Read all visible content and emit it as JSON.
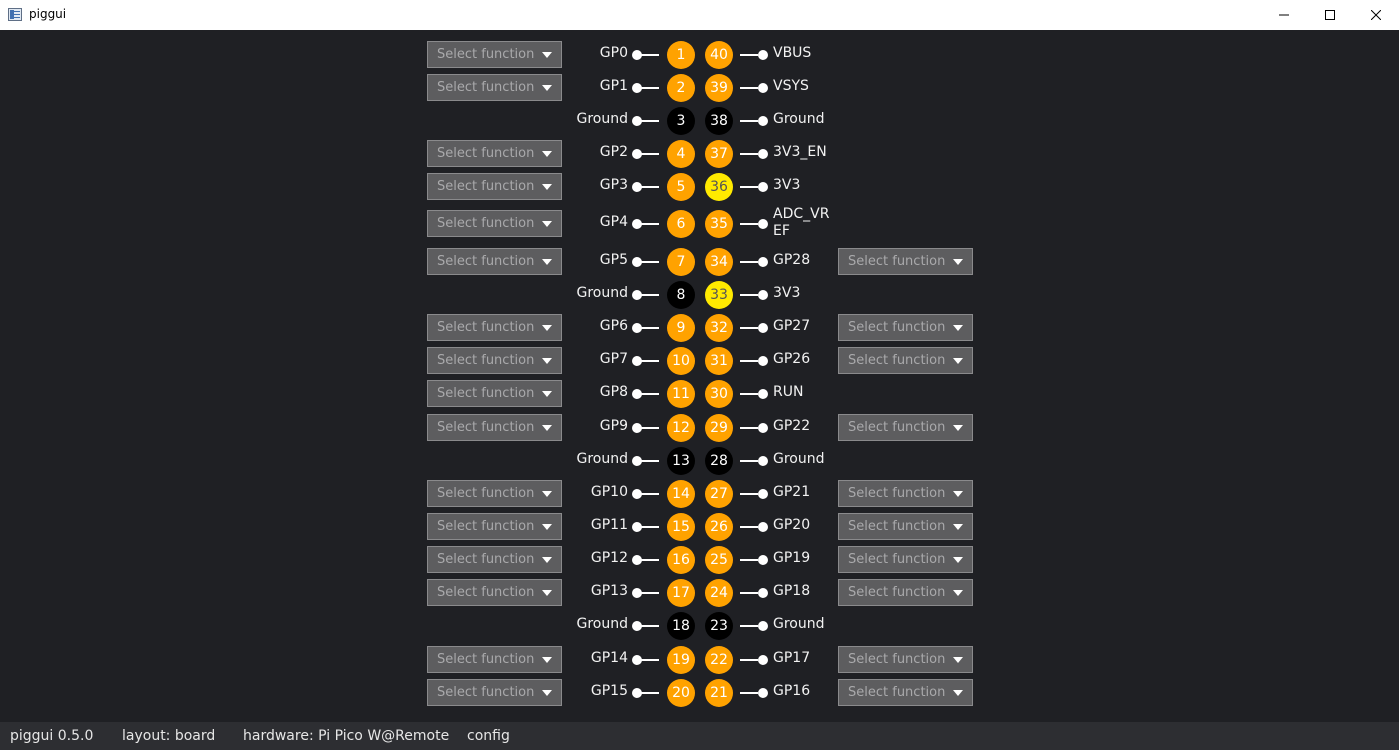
{
  "window": {
    "title": "piggui"
  },
  "select_placeholder": "Select function",
  "colors": {
    "gpio": "#ffa200",
    "ground": "#000000",
    "power_3v3": "#ffea00",
    "background": "#1f2024"
  },
  "pins": [
    {
      "left": {
        "num": "1",
        "name": "GP0",
        "type": "gpio",
        "select": true
      },
      "right": {
        "num": "40",
        "name": "VBUS",
        "type": "gpio",
        "select": false
      }
    },
    {
      "left": {
        "num": "2",
        "name": "GP1",
        "type": "gpio",
        "select": true
      },
      "right": {
        "num": "39",
        "name": "VSYS",
        "type": "gpio",
        "select": false
      }
    },
    {
      "left": {
        "num": "3",
        "name": "Ground",
        "type": "ground",
        "select": false
      },
      "right": {
        "num": "38",
        "name": "Ground",
        "type": "ground",
        "select": false
      }
    },
    {
      "left": {
        "num": "4",
        "name": "GP2",
        "type": "gpio",
        "select": true
      },
      "right": {
        "num": "37",
        "name": "3V3_EN",
        "type": "gpio",
        "select": false
      }
    },
    {
      "left": {
        "num": "5",
        "name": "GP3",
        "type": "gpio",
        "select": true
      },
      "right": {
        "num": "36",
        "name": "3V3",
        "type": "power3v3",
        "select": false
      }
    },
    {
      "left": {
        "num": "6",
        "name": "GP4",
        "type": "gpio",
        "select": true
      },
      "right": {
        "num": "35",
        "name": "ADC_VREF",
        "type": "gpio",
        "select": false
      }
    },
    {
      "left": {
        "num": "7",
        "name": "GP5",
        "type": "gpio",
        "select": true
      },
      "right": {
        "num": "34",
        "name": "GP28",
        "type": "gpio",
        "select": true
      }
    },
    {
      "left": {
        "num": "8",
        "name": "Ground",
        "type": "ground",
        "select": false
      },
      "right": {
        "num": "33",
        "name": "3V3",
        "type": "power3v3",
        "select": false
      }
    },
    {
      "left": {
        "num": "9",
        "name": "GP6",
        "type": "gpio",
        "select": true
      },
      "right": {
        "num": "32",
        "name": "GP27",
        "type": "gpio",
        "select": true
      }
    },
    {
      "left": {
        "num": "10",
        "name": "GP7",
        "type": "gpio",
        "select": true
      },
      "right": {
        "num": "31",
        "name": "GP26",
        "type": "gpio",
        "select": true
      }
    },
    {
      "left": {
        "num": "11",
        "name": "GP8",
        "type": "gpio",
        "select": true
      },
      "right": {
        "num": "30",
        "name": "RUN",
        "type": "gpio",
        "select": false
      }
    },
    {
      "left": {
        "num": "12",
        "name": "GP9",
        "type": "gpio",
        "select": true
      },
      "right": {
        "num": "29",
        "name": "GP22",
        "type": "gpio",
        "select": true
      }
    },
    {
      "left": {
        "num": "13",
        "name": "Ground",
        "type": "ground",
        "select": false
      },
      "right": {
        "num": "28",
        "name": "Ground",
        "type": "ground",
        "select": false
      }
    },
    {
      "left": {
        "num": "14",
        "name": "GP10",
        "type": "gpio",
        "select": true
      },
      "right": {
        "num": "27",
        "name": "GP21",
        "type": "gpio",
        "select": true
      }
    },
    {
      "left": {
        "num": "15",
        "name": "GP11",
        "type": "gpio",
        "select": true
      },
      "right": {
        "num": "26",
        "name": "GP20",
        "type": "gpio",
        "select": true
      }
    },
    {
      "left": {
        "num": "16",
        "name": "GP12",
        "type": "gpio",
        "select": true
      },
      "right": {
        "num": "25",
        "name": "GP19",
        "type": "gpio",
        "select": true
      }
    },
    {
      "left": {
        "num": "17",
        "name": "GP13",
        "type": "gpio",
        "select": true
      },
      "right": {
        "num": "24",
        "name": "GP18",
        "type": "gpio",
        "select": true
      }
    },
    {
      "left": {
        "num": "18",
        "name": "Ground",
        "type": "ground",
        "select": false
      },
      "right": {
        "num": "23",
        "name": "Ground",
        "type": "ground",
        "select": false
      }
    },
    {
      "left": {
        "num": "19",
        "name": "GP14",
        "type": "gpio",
        "select": true
      },
      "right": {
        "num": "22",
        "name": "GP17",
        "type": "gpio",
        "select": true
      }
    },
    {
      "left": {
        "num": "20",
        "name": "GP15",
        "type": "gpio",
        "select": true
      },
      "right": {
        "num": "21",
        "name": "GP16",
        "type": "gpio",
        "select": true
      }
    }
  ],
  "statusbar": {
    "version": "piggui 0.5.0",
    "layout": "layout: board",
    "hardware": "hardware: Pi Pico W@Remote",
    "config": "config"
  }
}
